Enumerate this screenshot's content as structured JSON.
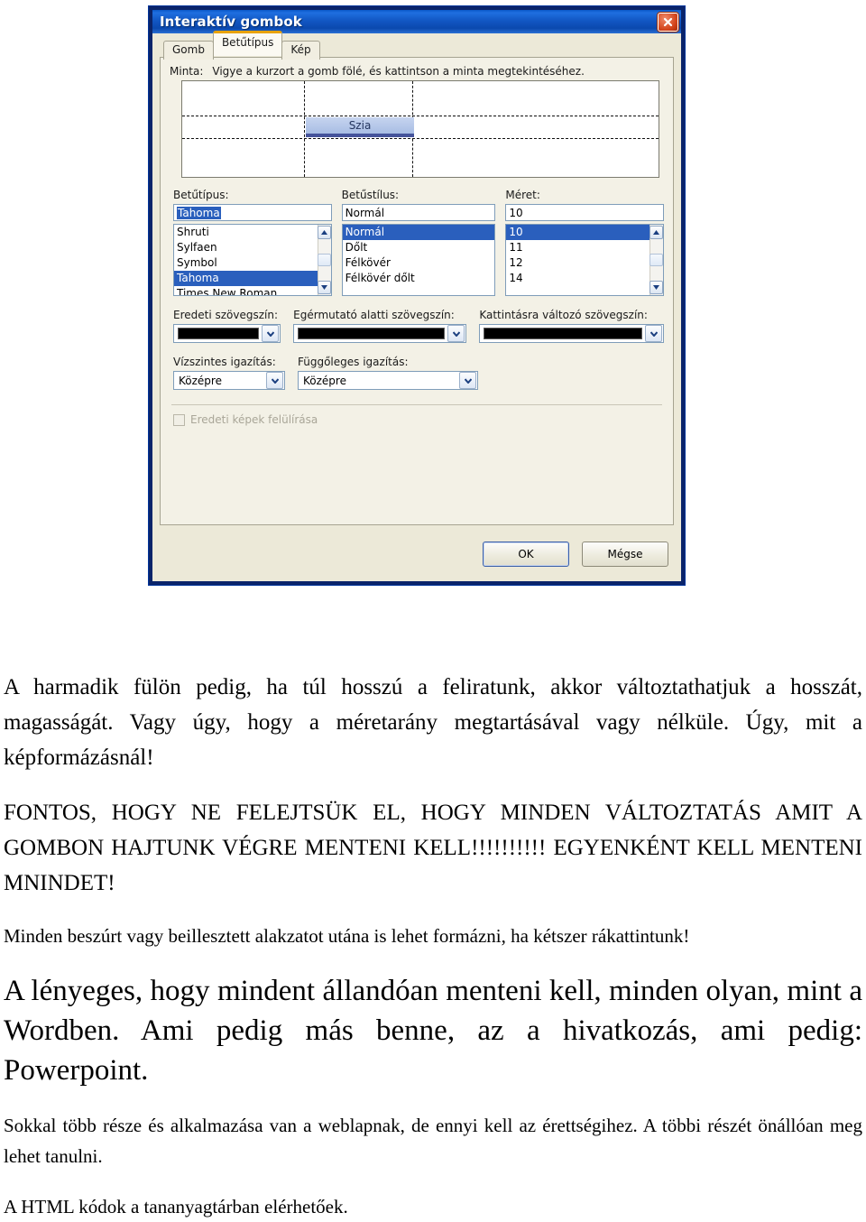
{
  "dialog": {
    "title": "Interaktív gombok",
    "close_icon": "close-icon",
    "tabs": [
      {
        "label": "Gomb",
        "active": false
      },
      {
        "label": "Betűtípus",
        "active": true
      },
      {
        "label": "Kép",
        "active": false
      }
    ],
    "sample": {
      "label": "Minta:",
      "hint": "Vigye a kurzort a gomb fölé, és kattintson a minta megtekintéséhez.",
      "button_text": "Szia"
    },
    "font": {
      "label": "Betűtípus:",
      "value": "Tahoma",
      "options": [
        "Shruti",
        "Sylfaen",
        "Symbol",
        "Tahoma",
        "Times New Roman"
      ],
      "selected": "Tahoma"
    },
    "style": {
      "label": "Betűstílus:",
      "value": "Normál",
      "options": [
        "Normál",
        "Dőlt",
        "Félkövér",
        "Félkövér dőlt"
      ],
      "selected": "Normál"
    },
    "size": {
      "label": "Méret:",
      "value": "10",
      "options": [
        "10",
        "11",
        "12",
        "14"
      ],
      "selected": "10"
    },
    "colors": [
      {
        "label": "Eredeti szövegszín:",
        "value": "#000000"
      },
      {
        "label": "Egérmutató alatti szövegszín:",
        "value": "#000000"
      },
      {
        "label": "Kattintásra változó szövegszín:",
        "value": "#000000"
      }
    ],
    "align": [
      {
        "label": "Vízszintes igazítás:",
        "value": "Középre"
      },
      {
        "label": "Függőleges igazítás:",
        "value": "Középre"
      }
    ],
    "checkbox": {
      "label": "Eredeti képek felülírása",
      "checked": false
    },
    "buttons": {
      "ok": "OK",
      "cancel": "Mégse"
    }
  },
  "document": {
    "paragraphs": [
      "A harmadik fülön pedig, ha túl hosszú a feliratunk, akkor változtathatjuk a hosszát, magasságát. Vagy úgy, hogy a méretarány megtartásával vagy nélküle. Úgy, mit a képformázásnál!",
      "FONTOS, HOGY NE FELEJTSÜK EL, HOGY MINDEN VÁLTOZTATÁS AMIT A GOMBON HAJTUNK VÉGRE MENTENI KELL!!!!!!!!!! EGYENKÉNT KELL MENTENI MNINDET!",
      "Minden beszúrt vagy beillesztett alakzatot utána is lehet formázni, ha kétszer rákattintunk!",
      "A lényeges, hogy mindent állandóan menteni kell, minden olyan, mint a Wordben. Ami pedig más benne, az a hivatkozás, ami pedig: Powerpoint.",
      "Sokkal több része és alkalmazása van a weblapnak, de ennyi kell az érettségihez. A többi részét önállóan meg lehet tanulni.",
      "A HTML kódok a tananyagtárban elérhetőek."
    ]
  }
}
